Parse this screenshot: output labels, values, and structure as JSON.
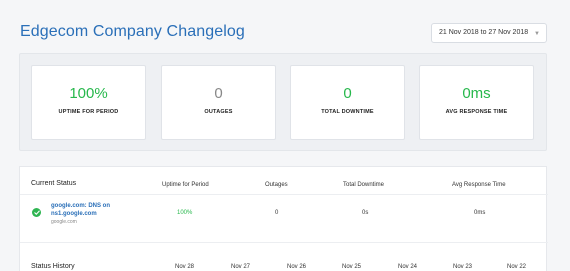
{
  "header": {
    "title": "Edgecom Company Changelog",
    "date_range": "21 Nov 2018 to 27 Nov 2018"
  },
  "stats": [
    {
      "value": "100%",
      "label": "UPTIME FOR PERIOD",
      "color": "#27b84c"
    },
    {
      "value": "0",
      "label": "OUTAGES",
      "color": "#888888"
    },
    {
      "value": "0",
      "label": "TOTAL DOWNTIME",
      "color": "#27b84c"
    },
    {
      "value": "0ms",
      "label": "AVG RESPONSE TIME",
      "color": "#27b84c"
    }
  ],
  "current_status": {
    "title": "Current Status",
    "columns": [
      "Uptime for Period",
      "Outages",
      "Total Downtime",
      "Avg Response Time"
    ],
    "rows": [
      {
        "name": "google.com: DNS on ns1.google.com",
        "host": "google.com",
        "status_icon": "check-circle-icon",
        "uptime": "100%",
        "outages": "0",
        "downtime": "0s",
        "avg_response": "0ms"
      }
    ]
  },
  "status_history": {
    "title": "Status History",
    "dates": [
      "Nov 28",
      "Nov 27",
      "Nov 26",
      "Nov 25",
      "Nov 24",
      "Nov 23",
      "Nov 22"
    ]
  },
  "colors": {
    "accent": "#2a6fb8",
    "success": "#27b84c",
    "background": "#f5f6f8"
  }
}
